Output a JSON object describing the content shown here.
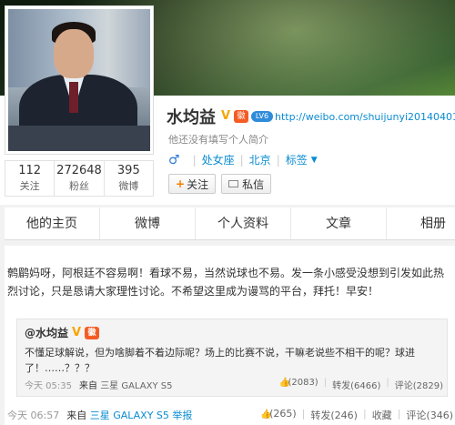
{
  "profile": {
    "name": "水均益",
    "verified_mark": "V",
    "badge_text": "徽",
    "level_text": "LV6",
    "url": "http://weibo.com/shuijunyi20140401",
    "intro": "他还没有填写个人简介",
    "gender_symbol": "♂",
    "zodiac": "处女座",
    "location": "北京",
    "tags_label": "标签",
    "follow_label": "关注",
    "message_label": "私信"
  },
  "stats": [
    {
      "value": "112",
      "label": "关注"
    },
    {
      "value": "272648",
      "label": "粉丝"
    },
    {
      "value": "395",
      "label": "微博"
    }
  ],
  "tabs": [
    {
      "label": "他的主页"
    },
    {
      "label": "微博"
    },
    {
      "label": "个人资料"
    },
    {
      "label": "文章"
    },
    {
      "label": "相册"
    }
  ],
  "post": {
    "text": "鹩鹛妈呀，阿根廷不容易啊！看球不易，当然说球也不易。发一条小感受没想到引发如此热烈讨论，只是恳请大家理性讨论。不希望这里成为谩骂的平台，拜托！早安！",
    "time": "今天 06:57",
    "source_prefix": "来自",
    "source": "三星 GALAXY S5",
    "report": "举报",
    "like": "(265)",
    "repost": "转发(246)",
    "favorite": "收藏",
    "comment": "评论(346)"
  },
  "quoted": {
    "author": "@水均益",
    "text": "不懂足球解说，但为啥脚着不着边际呢？场上的比赛不说，干嘛老说些不相干的呢？球进了！……？？？",
    "time": "今天 05:35",
    "source_prefix": "来自",
    "source": "三星 GALAXY S5",
    "like": "(2083)",
    "repost": "转发(6466)",
    "comment": "评论(2829)"
  },
  "colors": {
    "link": "#0a8cd2",
    "verified": "#f7a600",
    "badge": "#f45c23"
  }
}
